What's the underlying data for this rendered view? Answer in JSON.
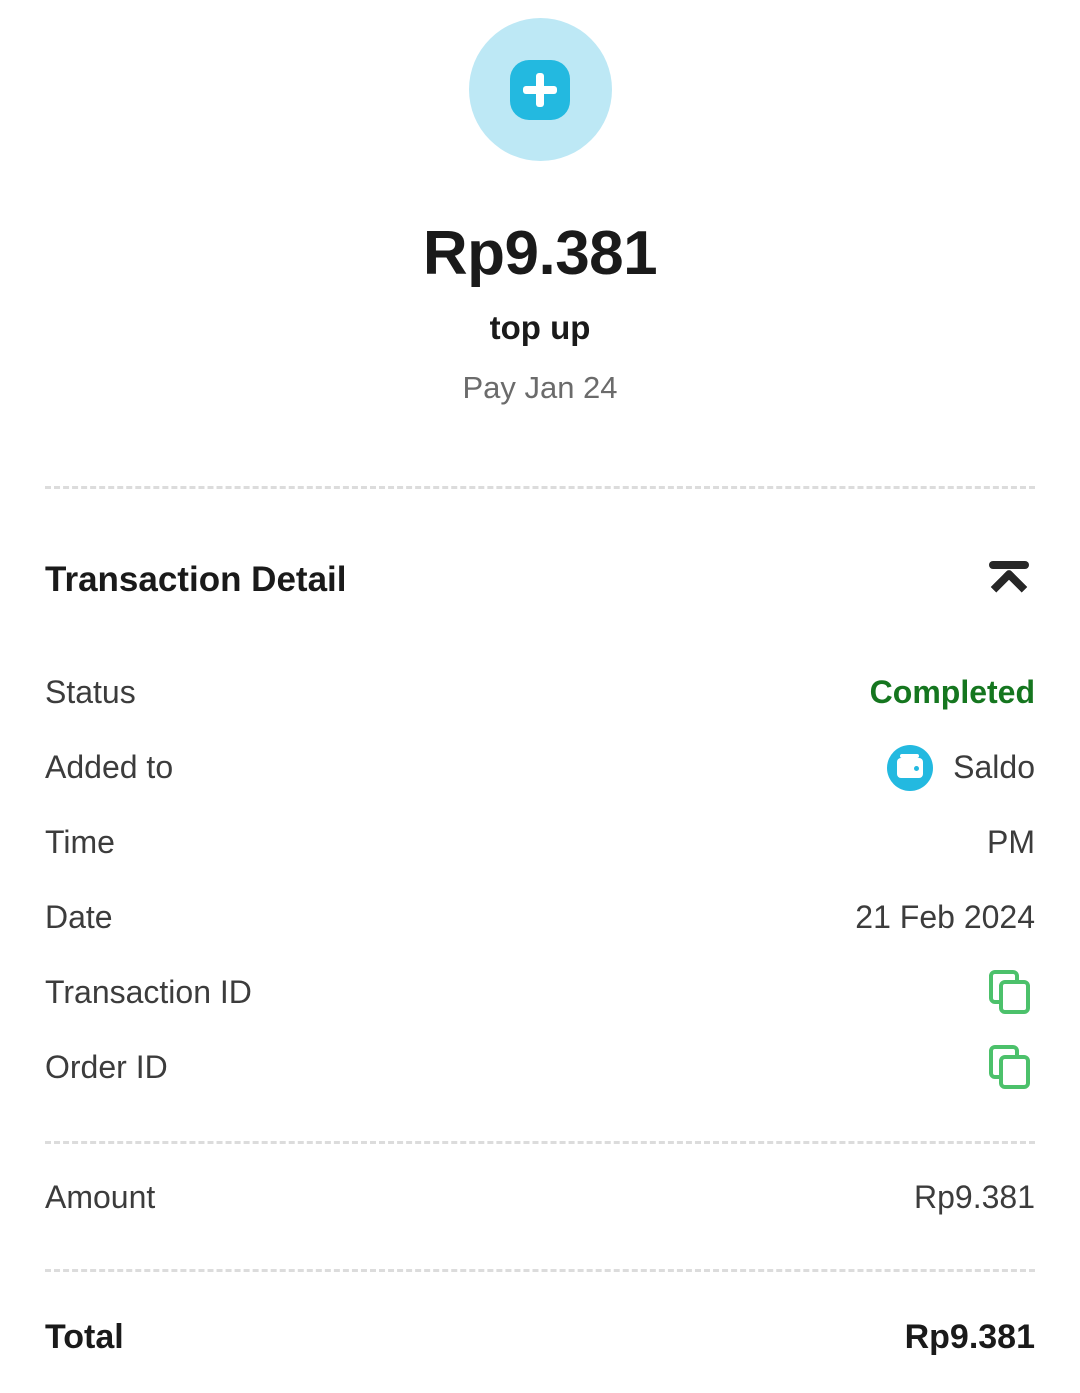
{
  "hero": {
    "icon": "plus-topup-icon",
    "amount": "Rp9.381",
    "transaction_type": "top up",
    "pay_label": "Pay Jan 24"
  },
  "section": {
    "title": "Transaction Detail",
    "collapse_icon": "collapse-up-icon"
  },
  "details": {
    "rows": [
      {
        "label": "Status",
        "value": "Completed",
        "style": "completed",
        "icon": ""
      },
      {
        "label": "Added to",
        "value": "Saldo",
        "style": "plain",
        "icon": "wallet-icon"
      },
      {
        "label": "Time",
        "value": "PM",
        "style": "plain",
        "icon": ""
      },
      {
        "label": "Date",
        "value": "21 Feb 2024",
        "style": "plain",
        "icon": ""
      },
      {
        "label": "Transaction ID",
        "value": "",
        "style": "plain",
        "icon": "copy-icon"
      },
      {
        "label": "Order ID",
        "value": "",
        "style": "plain",
        "icon": "copy-icon"
      }
    ]
  },
  "amount_section": {
    "label": "Amount",
    "value": "Rp9.381"
  },
  "total_section": {
    "label": "Total",
    "value": "Rp9.381"
  },
  "colors": {
    "accent_cyan": "#23b9e0",
    "accent_cyan_light": "#bde8f5",
    "status_green": "#15761f",
    "copy_green": "#4cc16b",
    "text_dark": "#1a1a1a",
    "text_body": "#3c3c3c",
    "text_muted": "#6b6b6b",
    "divider": "#dcdcdc"
  }
}
